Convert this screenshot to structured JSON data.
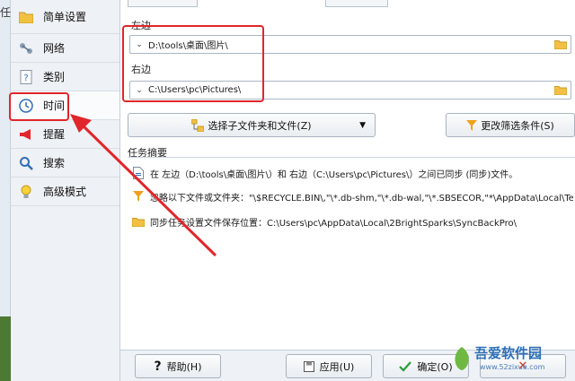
{
  "left_strip": {
    "char": "任"
  },
  "sidebar": {
    "items": [
      {
        "label": "简单设置",
        "icon": "folder-icon"
      },
      {
        "label": "网络",
        "icon": "network-icon"
      },
      {
        "label": "类别",
        "icon": "question-file-icon"
      },
      {
        "label": "时间",
        "icon": "clock-icon"
      },
      {
        "label": "提醒",
        "icon": "megaphone-icon"
      },
      {
        "label": "搜索",
        "icon": "magnifier-icon"
      },
      {
        "label": "高级模式",
        "icon": "lightbulb-icon"
      }
    ],
    "active_index": 3
  },
  "main": {
    "left_label": "左边",
    "left_path": "D:\\tools\\桌面\\图片\\",
    "right_label": "右边",
    "right_path": "C:\\Users\\pc\\Pictures\\",
    "select_button": "选择子文件夹和文件(Z)",
    "filter_button": "更改筛选条件(S)",
    "summary_title": "任务摘要",
    "summary_rows": [
      {
        "icon": "file-icon",
        "text": "在 左边（D:\\tools\\桌面\\图片\\）和 右边（C:\\Users\\pc\\Pictures\\）之间已同步 (同步)文件。"
      },
      {
        "icon": "filter-icon",
        "text": "忽略以下文件或文件夹：\"\\$RECYCLE.BIN\\,\"\\*.db-shm,\"\\*.db-wal,\"\\*.SBSECOR,\"*\\AppData\\Local\\Temporar..."
      },
      {
        "icon": "folder-icon",
        "text": "同步任务设置文件保存位置：C:\\Users\\pc\\AppData\\Local\\2BrightSparks\\SyncBackPro\\"
      }
    ]
  },
  "footer": {
    "help": "帮助(H)",
    "apply": "应用(U)",
    "ok": "确定(O)"
  },
  "watermark": {
    "title": "吾爱软件园",
    "url": "www.52zixue.com"
  },
  "colors": {
    "annotation": "#e0262b",
    "accent_orange": "#f0a020",
    "folder": "#f3c142"
  }
}
